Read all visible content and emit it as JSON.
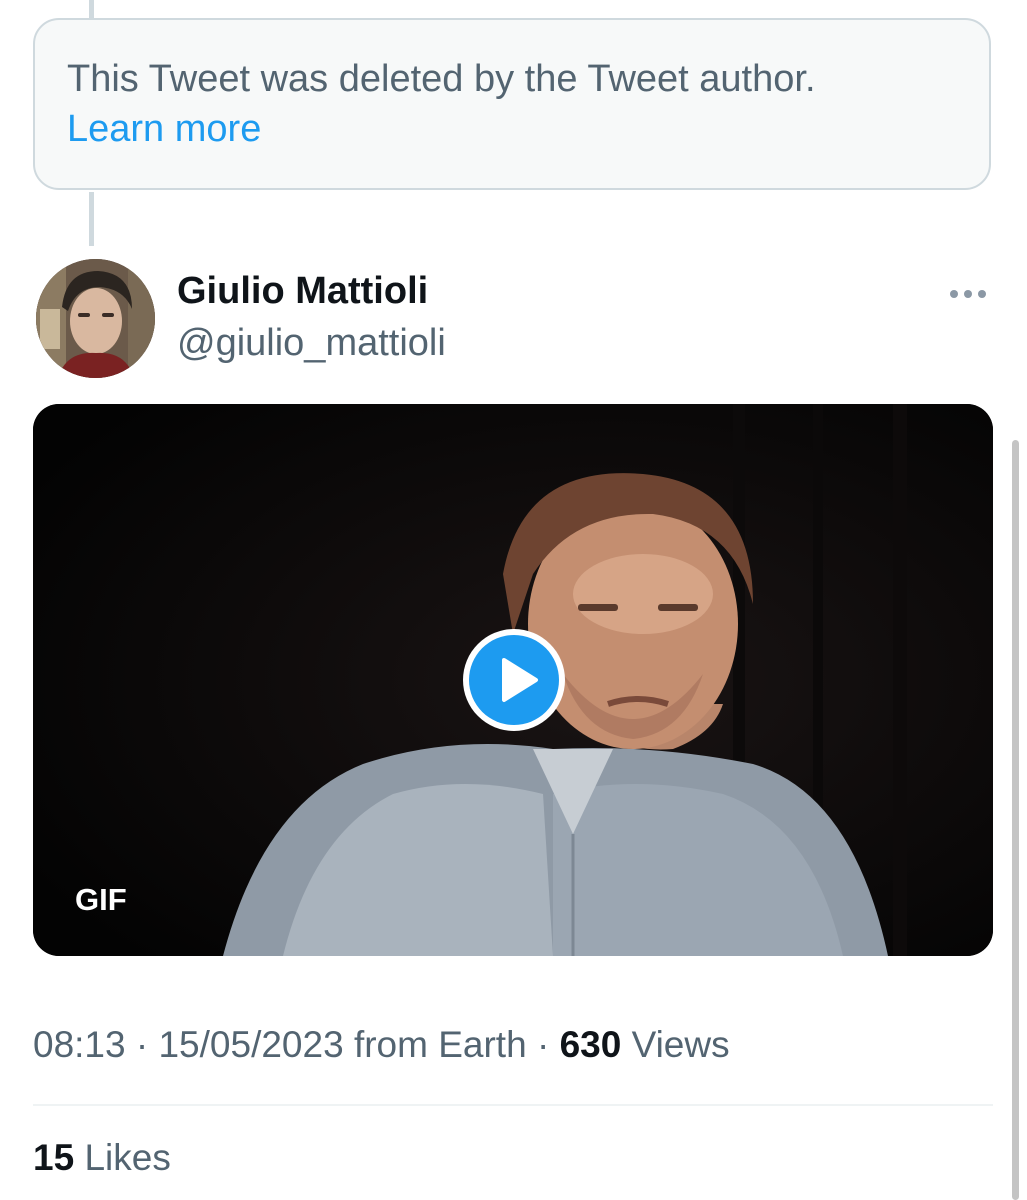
{
  "deleted_notice": {
    "text": "This Tweet was deleted by the Tweet author.",
    "link_label": "Learn more"
  },
  "tweet": {
    "author_name": "Giulio Mattioli",
    "author_handle": "@giulio_mattioli",
    "media": {
      "badge": "GIF",
      "play_icon": "play-icon"
    },
    "time": "08:13",
    "separator": "·",
    "date": "15/05/2023",
    "source": "from Earth",
    "views_count": "630",
    "views_label": "Views",
    "likes_count": "15",
    "likes_label": "Likes"
  },
  "colors": {
    "accent": "#1d9bf0",
    "secondary_text": "#536471",
    "primary_text": "#0f1419",
    "notice_background": "#f7f9f9",
    "border": "#cfd9de"
  }
}
